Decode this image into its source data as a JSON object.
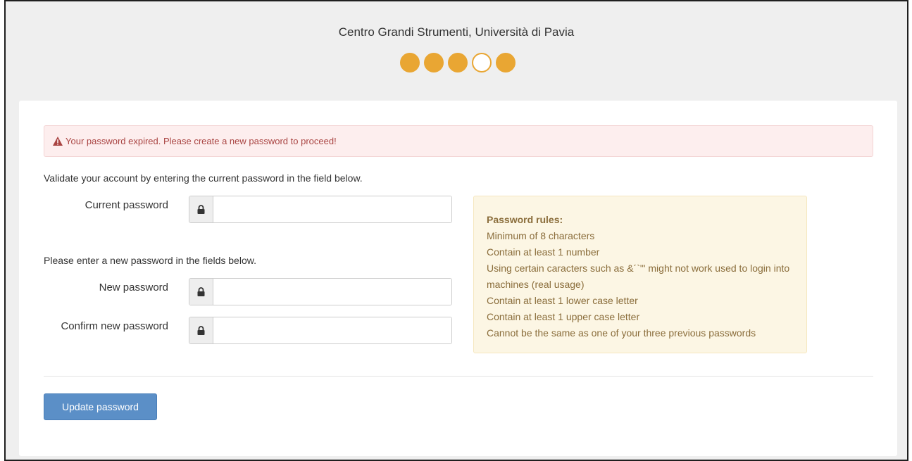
{
  "header": {
    "title": "Centro Grandi Strumenti, Università di Pavia",
    "steps": [
      {
        "filled": true
      },
      {
        "filled": true
      },
      {
        "filled": true
      },
      {
        "filled": false
      },
      {
        "filled": true
      }
    ],
    "step_color": "#e9a633"
  },
  "alert": {
    "icon": "warning-icon",
    "message": "Your password expired. Please create a new password to proceed!"
  },
  "current_section": {
    "intro": "Validate your account by entering the current password in the field below.",
    "current_password_label": "Current password",
    "current_password_value": ""
  },
  "new_section": {
    "intro": "Please enter a new password in the fields below.",
    "new_password_label": "New password",
    "new_password_value": "",
    "confirm_password_label": "Confirm new password",
    "confirm_password_value": ""
  },
  "rules": {
    "title": "Password rules:",
    "items": [
      "Minimum of 8 characters",
      "Contain at least 1 number",
      "Using certain caracters such as &´`\"' might not work used to login into machines (real usage)",
      "Contain at least 1 lower case letter",
      "Contain at least 1 upper case letter",
      "Cannot be the same as one of your three previous passwords"
    ]
  },
  "actions": {
    "update_label": "Update password",
    "button_color": "#5b8fc7"
  }
}
